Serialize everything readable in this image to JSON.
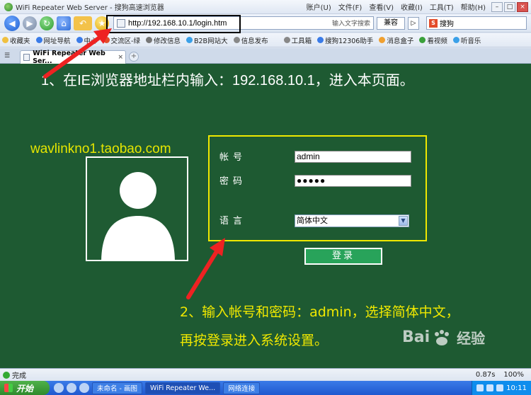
{
  "window": {
    "title": "WiFi Repeater Web Server - 搜狗高速浏览器",
    "menus": [
      "账户(U)",
      "文件(F)",
      "查看(V)",
      "收藏(I)",
      "工具(T)",
      "帮助(H)"
    ]
  },
  "navbar": {
    "url": "http://192.168.10.1/login.htm",
    "input_hint": "输入文字搜索",
    "compat_label": "兼容",
    "search_label": "搜狗"
  },
  "favorites": [
    "收藏夹",
    "网址导航",
    "中心",
    "交流区-绿",
    "修改信息",
    "B2B网站大",
    "信息发布",
    "工具箱",
    "搜狗12306助手",
    "消息盒子",
    "看视频",
    "听音乐"
  ],
  "tab": {
    "label": "WiFi Repeater Web Ser..."
  },
  "page": {
    "step1": "1、在IE浏览器地址栏内输入：192.168.10.1，进入本页面。",
    "taobao": "wavlinkno1.taobao.com",
    "form": {
      "username_label": "帐号",
      "username_value": "admin",
      "password_label": "密码",
      "password_value": "●●●●●",
      "language_label": "语言",
      "language_value": "简体中文"
    },
    "login_button": "登录",
    "step2_line1": "2、输入帐号和密码：admin，选择简体中文，",
    "step2_line2": "再按登录进入系统设置。",
    "watermark_text": "Bai",
    "watermark_brand": "经验"
  },
  "statusbar": {
    "status": "完成",
    "speed": "0.87s",
    "zoom": "100%"
  },
  "taskbar": {
    "start": "开始",
    "tasks": [
      "未命名 - 画图",
      "WiFi Repeater We...",
      "网络连接"
    ],
    "clock": "10:11"
  }
}
